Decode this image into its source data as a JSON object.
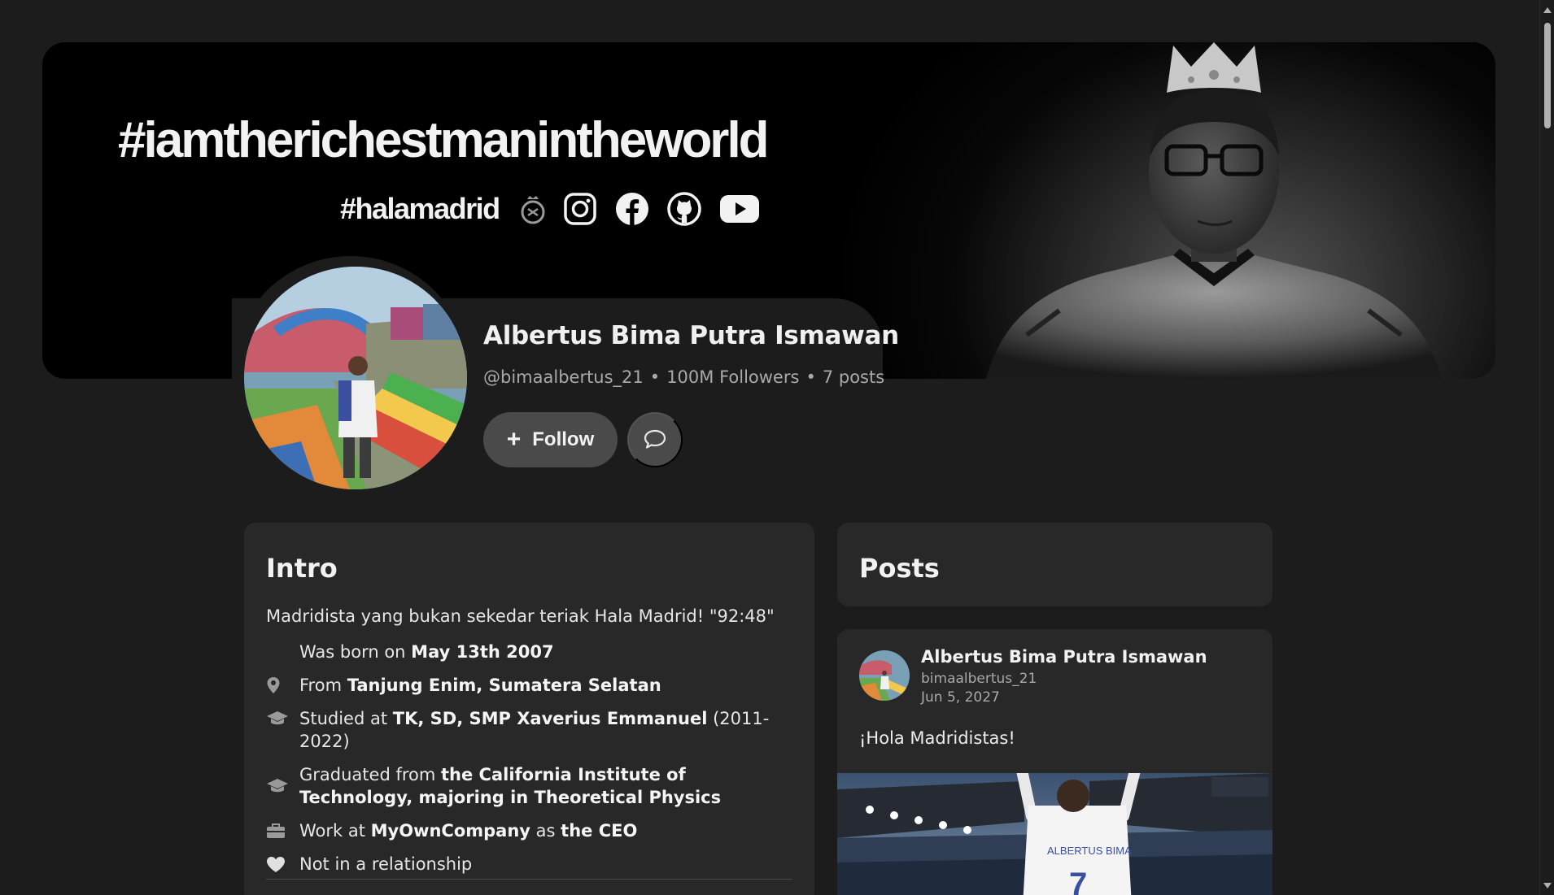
{
  "banner": {
    "hashtag_main": "#iamtherichestmanintheworld",
    "hashtag_sub": "#halamadrid",
    "social_icons": [
      "real-madrid-crest-icon",
      "instagram-icon",
      "facebook-icon",
      "github-icon",
      "youtube-icon"
    ]
  },
  "profile": {
    "name": "Albertus Bima Putra Ismawan",
    "handle": "@bimaalbertus_21",
    "followers": "100M Followers",
    "posts": "7 posts",
    "separator": "•",
    "follow_label": "Follow",
    "follow_icon": "plus-icon",
    "message_icon": "chat-bubble-icon"
  },
  "intro": {
    "title": "Intro",
    "bio": "Madridista yang bukan sekedar teriak Hala Madrid! \"92:48\"",
    "born_prefix": "Was born on ",
    "born_value": "May 13th 2007",
    "from_prefix": "From ",
    "from_value": "Tanjung Enim, Sumatera Selatan",
    "studied_prefix": "Studied at ",
    "studied_value": "TK, SD, SMP Xaverius Emmanuel",
    "studied_suffix": " (2011-2022)",
    "graduated_prefix": "Graduated from ",
    "graduated_value": "the California Institute of Technology, majoring in Theoretical Physics",
    "work_prefix": "Work at ",
    "work_company": "MyOwnCompany",
    "work_mid": " as ",
    "work_role": "the CEO",
    "relationship": "Not in a relationship"
  },
  "posts": {
    "title": "Posts",
    "items": [
      {
        "author": "Albertus Bima Putra Ismawan",
        "handle": "bimaalbertus_21",
        "date": "Jun 5, 2027",
        "text": "¡Hola Madridistas!",
        "jersey_name": "ALBERTUS BIMA",
        "jersey_number": "7"
      }
    ]
  },
  "colors": {
    "page_bg": "#1c1c1c",
    "card_bg": "#282828",
    "button_bg": "#4a4a4a",
    "muted_text": "#a9a9a9"
  }
}
